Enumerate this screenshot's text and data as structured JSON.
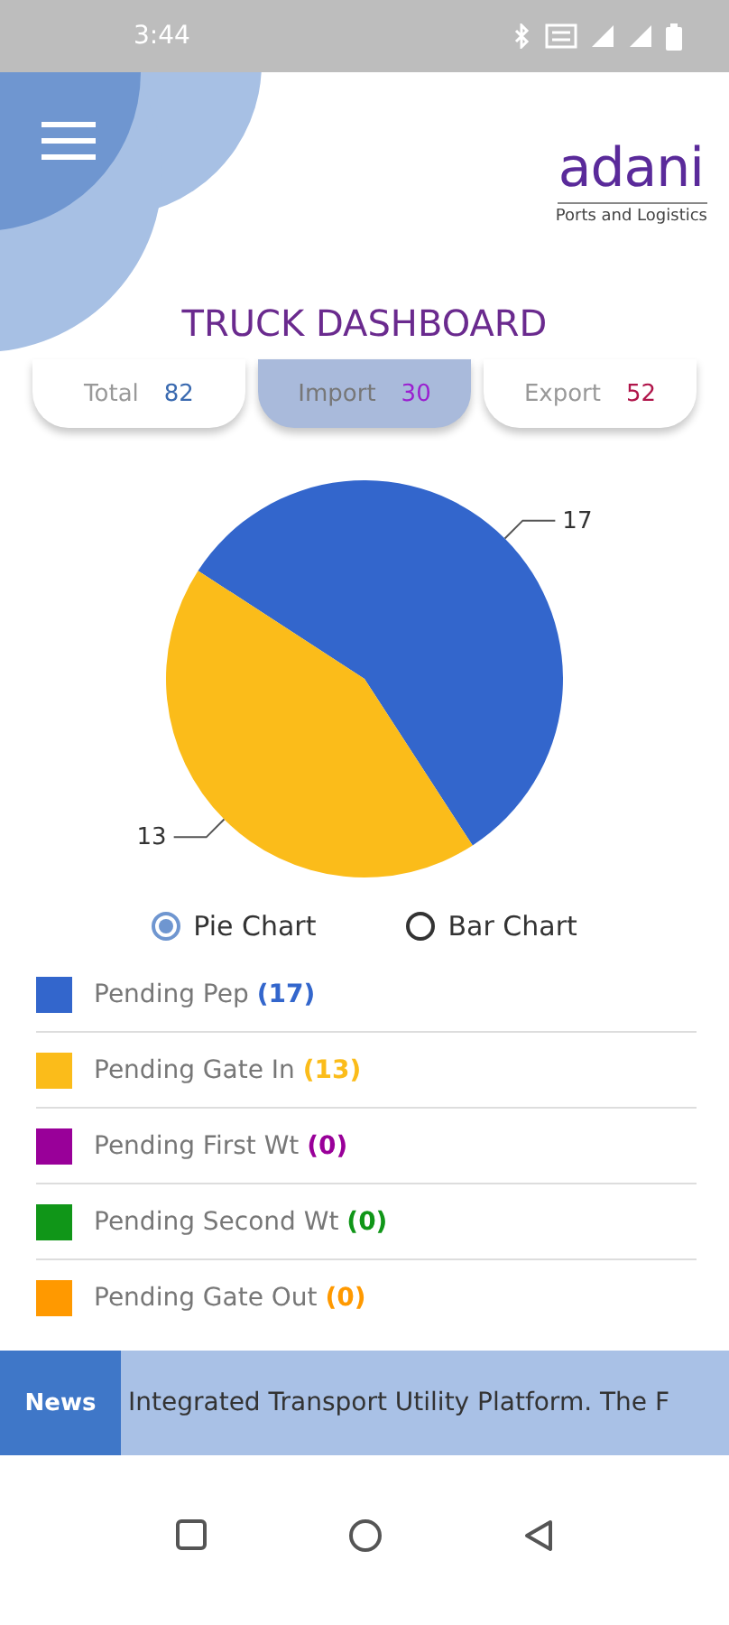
{
  "status_bar": {
    "time": "3:44"
  },
  "header": {
    "logo": "adani",
    "logo_subtitle": "Ports and Logistics",
    "title": "TRUCK DASHBOARD"
  },
  "stats": [
    {
      "label": "Total",
      "value": "82",
      "color": "#3a6ab0",
      "selected": false
    },
    {
      "label": "Import",
      "value": "30",
      "color": "#9b1fd0",
      "selected": true
    },
    {
      "label": "Export",
      "value": "52",
      "color": "#b0154a",
      "selected": false
    }
  ],
  "chart": {
    "chart_data": {
      "type": "pie",
      "values": [
        17,
        13
      ],
      "data_labels": true
    }
  },
  "chart_options": [
    {
      "label": "Pie Chart",
      "selected": true
    },
    {
      "label": "Bar Chart",
      "selected": false
    }
  ],
  "legend": [
    {
      "label": "Pending Pep",
      "count": "(17)",
      "color": "#3366cc"
    },
    {
      "label": "Pending Gate In",
      "count": "(13)",
      "color": "#fbbc1a"
    },
    {
      "label": "Pending First Wt",
      "count": "(0)",
      "color": "#990099"
    },
    {
      "label": "Pending Second Wt",
      "count": "(0)",
      "color": "#109618"
    },
    {
      "label": "Pending Gate Out",
      "count": "(0)",
      "color": "#ff9900"
    }
  ],
  "news": {
    "label": "News",
    "text": "Integrated Transport Utility Platform. The F"
  }
}
